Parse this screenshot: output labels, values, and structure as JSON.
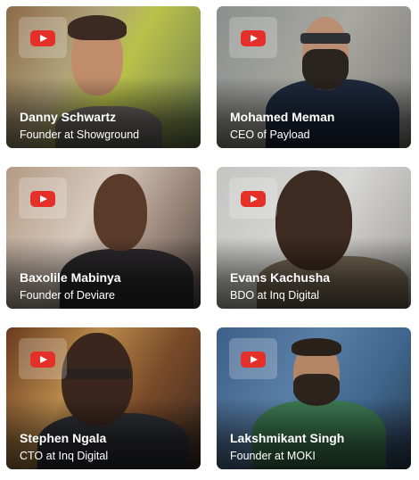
{
  "cards": [
    {
      "name": "Danny Schwartz",
      "role": "Founder at Showground",
      "play_icon": "youtube-play-icon"
    },
    {
      "name": "Mohamed Meman",
      "role": "CEO of Payload",
      "play_icon": "youtube-play-icon"
    },
    {
      "name": "Baxolile Mabinya",
      "role": "Founder of Deviare",
      "play_icon": "youtube-play-icon"
    },
    {
      "name": "Evans Kachusha",
      "role": "BDO at Inq Digital",
      "play_icon": "youtube-play-icon"
    },
    {
      "name": "Stephen Ngala",
      "role": "CTO at Inq Digital",
      "play_icon": "youtube-play-icon"
    },
    {
      "name": "Lakshmikant Singh",
      "role": "Founder at MOKI",
      "play_icon": "youtube-play-icon"
    }
  ],
  "colors": {
    "play_button": "#e5302a",
    "text": "#ffffff"
  }
}
